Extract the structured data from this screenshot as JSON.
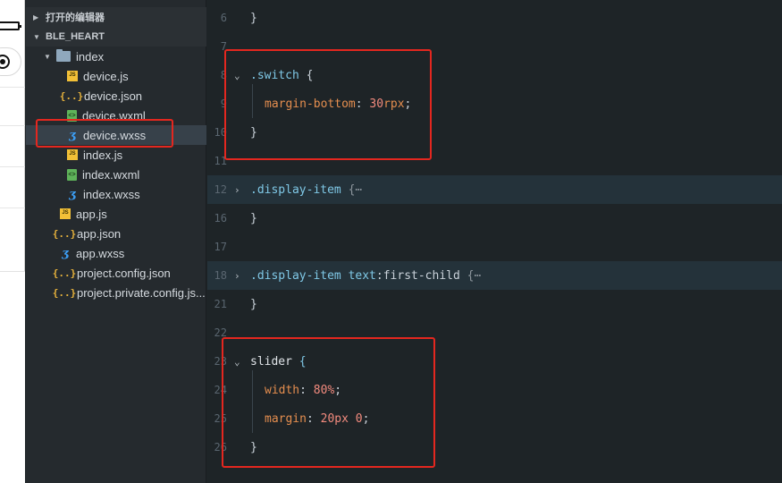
{
  "explorer": {
    "open_editors_label": "打开的编辑器",
    "project_label": "BLE_HEART",
    "items": [
      {
        "label": "index",
        "type": "folder"
      },
      {
        "label": "device.js",
        "type": "js"
      },
      {
        "label": "device.json",
        "type": "json"
      },
      {
        "label": "device.wxml",
        "type": "wxml"
      },
      {
        "label": "device.wxss",
        "type": "wxss",
        "selected": true
      },
      {
        "label": "index.js",
        "type": "js"
      },
      {
        "label": "index.wxml",
        "type": "wxml"
      },
      {
        "label": "index.wxss",
        "type": "wxss"
      },
      {
        "label": "app.js",
        "type": "js"
      },
      {
        "label": "app.json",
        "type": "json"
      },
      {
        "label": "app.wxss",
        "type": "wxss"
      },
      {
        "label": "project.config.json",
        "type": "json"
      },
      {
        "label": "project.private.config.js...",
        "type": "json"
      }
    ],
    "icons": {
      "js": "JS",
      "json": "{..}",
      "wxml": "<>",
      "wxss": "ʒ"
    }
  },
  "editor": {
    "lines": {
      "l6": {
        "num": "6",
        "text": "}"
      },
      "l7": {
        "num": "7"
      },
      "l8": {
        "num": "8",
        "selector": ".switch",
        "brace": "{"
      },
      "l9": {
        "num": "9",
        "prop": "margin-bottom",
        "value": "30",
        "unit": "rpx"
      },
      "l10": {
        "num": "10",
        "text": "}"
      },
      "l11": {
        "num": "11"
      },
      "l12": {
        "num": "12",
        "selector": ".display-item",
        "collapsed": "{⋯"
      },
      "l16": {
        "num": "16",
        "text": "}"
      },
      "l17": {
        "num": "17"
      },
      "l18": {
        "num": "18",
        "selector": ".display-item",
        "selector2": "text",
        "pseudo": ":first-child",
        "collapsed": "{⋯"
      },
      "l21": {
        "num": "21",
        "text": "}"
      },
      "l22": {
        "num": "22"
      },
      "l23": {
        "num": "23",
        "selector": "slider",
        "brace": "{"
      },
      "l24": {
        "num": "24",
        "prop": "width",
        "value": "80%"
      },
      "l25": {
        "num": "25",
        "prop": "margin",
        "value": "20px 0"
      },
      "l26": {
        "num": "26",
        "text": "}"
      }
    }
  },
  "colors": {
    "annotation": "#e4271f",
    "selected_row": "#37414a"
  }
}
